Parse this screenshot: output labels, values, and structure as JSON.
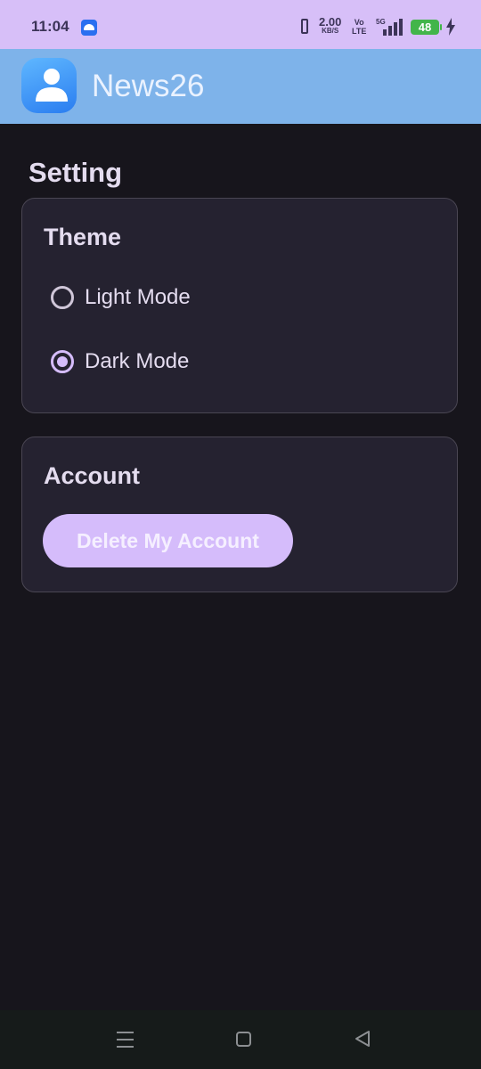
{
  "status_bar": {
    "time": "11:04",
    "net_speed_value": "2.00",
    "net_speed_unit": "KB/S",
    "volte_top": "Vo",
    "volte_bottom": "LTE",
    "network_type": "5G",
    "battery_level": "48",
    "icons": [
      "android-notification-icon",
      "vibrate-icon",
      "signal-icon",
      "battery-icon",
      "charging-icon"
    ]
  },
  "app_bar": {
    "title": "News26",
    "logo_icon": "person-icon"
  },
  "page": {
    "title": "Setting"
  },
  "theme_card": {
    "title": "Theme",
    "options": [
      {
        "label": "Light Mode",
        "selected": false
      },
      {
        "label": "Dark Mode",
        "selected": true
      }
    ]
  },
  "account_card": {
    "title": "Account",
    "delete_label": "Delete My Account"
  },
  "nav_bar": {
    "icons": [
      "menu-icon",
      "home-icon",
      "back-icon"
    ]
  },
  "colors": {
    "status_bar": "#d7bff8",
    "app_bar": "#7eb3ea",
    "background": "#17151c",
    "card": "#252230",
    "accent": "#d5bcfb"
  }
}
